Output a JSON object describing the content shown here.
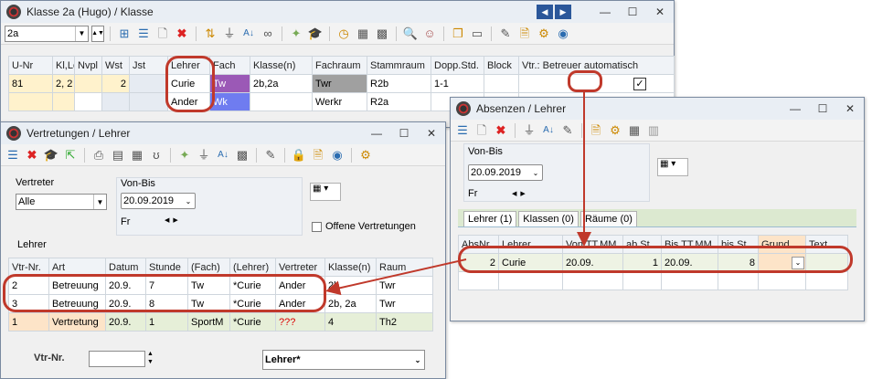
{
  "klasse_window": {
    "title": "Klasse 2a (Hugo) / Klasse",
    "class_select": "2a",
    "columns": [
      "U-Nr",
      "Kl,Le",
      "Nvpl",
      "Wst",
      "Jst",
      "Lehrer",
      "Fach",
      "Klasse(n)",
      "Fachraum",
      "Stammraum",
      "Dopp.Std.",
      "Block",
      "Vtr.: Betreuer automatisch"
    ],
    "row1": {
      "unr": "81",
      "kl": "2, 2",
      "wst": "2",
      "lehrer": "Curie",
      "fach": "Tw",
      "klassen": "2b,2a",
      "fachraum": "Twr",
      "stammraum": "R2b",
      "dopp": "1-1"
    },
    "row2": {
      "lehrer": "Ander",
      "fach": "Wk",
      "fachraum": "Werkr",
      "stammraum": "R2a"
    }
  },
  "vertretungen_window": {
    "title": "Vertretungen / Lehrer",
    "vertreter_label": "Vertreter",
    "vertreter_value": "Alle",
    "vonbis_label": "Von-Bis",
    "date_value": "20.09.2019",
    "day": "Fr",
    "offene_label": "Offene Vertretungen",
    "lehrer_label": "Lehrer",
    "columns": [
      "Vtr-Nr.",
      "Art",
      "Datum",
      "Stunde",
      "(Fach)",
      "(Lehrer)",
      "Vertreter",
      "Klasse(n)",
      "Raum"
    ],
    "rows": [
      {
        "nr": "2",
        "art": "Betreuung",
        "datum": "20.9.",
        "stunde": "7",
        "fach": "Tw",
        "lehrer": "*Curie",
        "vertreter": "Ander",
        "klassen": "2b",
        "raum": "Twr"
      },
      {
        "nr": "3",
        "art": "Betreuung",
        "datum": "20.9.",
        "stunde": "8",
        "fach": "Tw",
        "lehrer": "*Curie",
        "vertreter": "Ander",
        "klassen": "2b, 2a",
        "raum": "Twr"
      },
      {
        "nr": "1",
        "art": "Vertretung",
        "datum": "20.9.",
        "stunde": "1",
        "fach": "SportM",
        "lehrer": "*Curie",
        "vertreter": "???",
        "klassen": "4",
        "raum": "Th2"
      }
    ],
    "vtrnr_label": "Vtr-Nr.",
    "bottom_select": "Lehrer*"
  },
  "absenzen_window": {
    "title": "Absenzen / Lehrer",
    "vonbis_label": "Von-Bis",
    "date_value": "20.09.2019",
    "day": "Fr",
    "tabs": [
      "Lehrer (1)",
      "Klassen (0)",
      "Räume (0)"
    ],
    "columns": [
      "AbsNr.",
      "Lehrer",
      "Von TT.MM.",
      "ab St.",
      "Bis TT.MM.",
      "bis St.",
      "Grund",
      "Text"
    ],
    "row": {
      "nr": "2",
      "lehrer": "Curie",
      "von": "20.09.",
      "abst": "1",
      "bis": "20.09.",
      "bisst": "8"
    }
  },
  "colors": {
    "highlight": "#c0392b",
    "fach_tw": "#9b59b6",
    "fach_wk": "#6f7cf0",
    "raum_twr": "#a0a0a0"
  }
}
